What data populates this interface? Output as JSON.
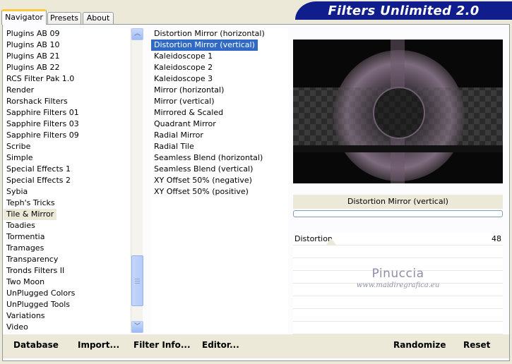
{
  "tabs": [
    {
      "label": "Navigator",
      "active": true
    },
    {
      "label": "Presets",
      "active": false
    },
    {
      "label": "About",
      "active": false
    }
  ],
  "title": "Filters Unlimited 2.0",
  "categories": {
    "items": [
      "Plugins AB 09",
      "Plugins AB 10",
      "Plugins AB 21",
      "Plugins AB 22",
      "RCS Filter Pak 1.0",
      "Render",
      "Rorshack Filters",
      "Sapphire Filters 01",
      "Sapphire Filters 03",
      "Sapphire Filters 09",
      "Scribe",
      "Simple",
      "Special Effects 1",
      "Special Effects 2",
      "Sybia",
      "Teph's Tricks",
      "Tile & Mirror",
      "Toadies",
      "Tormentia",
      "Tramages",
      "Transparency",
      "Tronds Filters II",
      "Two Moon",
      "UnPlugged Colors",
      "UnPlugged Tools",
      "Variations",
      "Video"
    ],
    "selected": "Tile & Mirror"
  },
  "filters": {
    "items": [
      "Distortion Mirror (horizontal)",
      "Distortion Mirror (vertical)",
      "Kaleidoscope 1",
      "Kaleidoscope 2",
      "Kaleidoscope 3",
      "Mirror (horizontal)",
      "Mirror (vertical)",
      "Mirrored & Scaled",
      "Quadrant Mirror",
      "Radial Mirror",
      "Radial Tile",
      "Seamless Blend (horizontal)",
      "Seamless Blend (vertical)",
      "XY Offset 50% (negative)",
      "XY Offset 50% (positive)"
    ],
    "selected": "Distortion Mirror (vertical)"
  },
  "preview": {
    "filter_name": "Distortion Mirror (vertical)"
  },
  "progress": 0,
  "parameters": [
    {
      "label": "Distortion",
      "value": "48"
    }
  ],
  "watermark": {
    "name": "Pinuccia",
    "url": "www.maidiregrafica.eu"
  },
  "buttons": {
    "database": "Database",
    "import": "Import...",
    "filter_info": "Filter Info...",
    "editor": "Editor...",
    "randomize": "Randomize",
    "reset": "Reset"
  },
  "colors": {
    "banner": "#0f1e8c",
    "selection": "#316ac5",
    "window": "#ece9d8",
    "preview_accent": "#7a6878"
  }
}
